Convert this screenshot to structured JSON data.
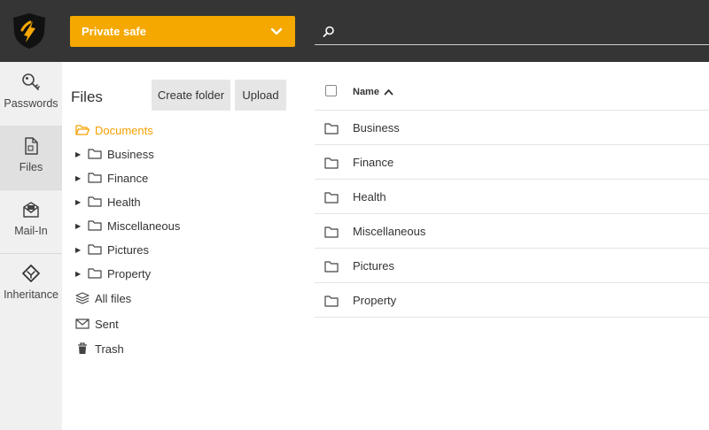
{
  "header": {
    "safe_selector": "Private safe",
    "search_placeholder": ""
  },
  "colors": {
    "accent": "#f5a800",
    "topbar": "#353535",
    "rail": "#f0f0f0"
  },
  "rail": {
    "items": [
      {
        "label": "Passwords",
        "icon": "key-icon"
      },
      {
        "label": "Files",
        "icon": "file-icon",
        "active": true
      },
      {
        "label": "Mail-In",
        "icon": "mail-in-icon"
      },
      {
        "label": "Inheritance",
        "icon": "inheritance-icon"
      }
    ]
  },
  "files_panel": {
    "title": "Files",
    "create_folder": "Create folder",
    "upload": "Upload",
    "root": "Documents",
    "folders": [
      "Business",
      "Finance",
      "Health",
      "Miscellaneous",
      "Pictures",
      "Property"
    ],
    "all_files": "All files",
    "sent": "Sent",
    "trash": "Trash"
  },
  "listing": {
    "name_header": "Name",
    "rows": [
      "Business",
      "Finance",
      "Health",
      "Miscellaneous",
      "Pictures",
      "Property"
    ]
  }
}
